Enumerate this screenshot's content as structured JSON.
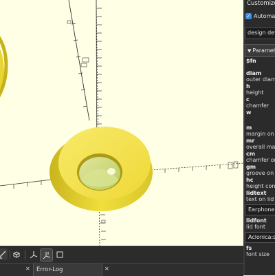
{
  "customizer": {
    "title": "Customizer",
    "auto_preview_label": "Automatic Preview",
    "preset_value": "design default values",
    "parameters_header": "Parameters",
    "params": [
      {
        "name": "$fn",
        "desc": ""
      },
      {
        "name": "diam",
        "desc": "outer diameter"
      },
      {
        "name": "h",
        "desc": "height"
      },
      {
        "name": "c",
        "desc": "chamfer"
      },
      {
        "name": "w",
        "desc": ""
      },
      {
        "name": "m",
        "desc": "margin on cut"
      },
      {
        "name": "mr",
        "desc": "overall margin"
      },
      {
        "name": "cm",
        "desc": "chamfer on margin"
      },
      {
        "name": "gm",
        "desc": "groove on the lid"
      },
      {
        "name": "hc",
        "desc": "height connector"
      },
      {
        "name": "lidtext",
        "desc": "text on lid",
        "value": "Earphone"
      },
      {
        "name": "lidfont",
        "desc": "lid font",
        "value": "Aclonica:style=Regular"
      },
      {
        "name": "fs",
        "desc": "font size"
      }
    ]
  },
  "toolbar": {
    "icons": [
      "perspective-icon",
      "views-icon",
      "axes-icon",
      "crosshairs-icon"
    ]
  },
  "bottom": {
    "close_glyph": "✕",
    "tab_label": "Error-Log",
    "tab_close_glyph": "✕"
  },
  "colors": {
    "viewport_bg": "#ffffe5",
    "model_yellow": "#f2e04a",
    "panel_dark": "#2b2b2b",
    "accent_blue": "#3d8ee6"
  }
}
